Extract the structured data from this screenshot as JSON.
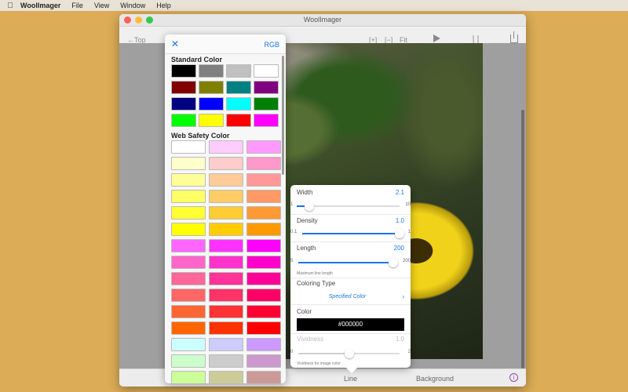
{
  "menubar": {
    "app": "WoolImager",
    "items": [
      "File",
      "View",
      "Window",
      "Help"
    ]
  },
  "window": {
    "title": "WoolImager"
  },
  "toolbar": {
    "back": "←Top",
    "expand": "[+]",
    "shrink": "[−]",
    "fit": "Fit"
  },
  "bottombar": {
    "line_tab": "Line",
    "background_tab": "Background"
  },
  "picker": {
    "rgb_label": "RGB",
    "standard_title": "Standard Color",
    "standard_colors": [
      "#000000",
      "#808080",
      "#c0c0c0",
      "#ffffff",
      "#800000",
      "#808000",
      "#008080",
      "#800080",
      "#000080",
      "#0000ff",
      "#00ffff",
      "#008000",
      "#00ff00",
      "#ffff00",
      "#ff0000",
      "#ff00ff"
    ],
    "web_title": "Web Safety Color",
    "web_colors": [
      "#ffffff",
      "#ffccff",
      "#ff99ff",
      "#ffffcc",
      "#ffcccc",
      "#ff99cc",
      "#ffff99",
      "#ffcc99",
      "#ff9999",
      "#ffff66",
      "#ffcc66",
      "#ff9966",
      "#ffff33",
      "#ffcc33",
      "#ff9933",
      "#ffff00",
      "#ffcc00",
      "#ff9900",
      "#ff66ff",
      "#ff33ff",
      "#ff00ff",
      "#ff66cc",
      "#ff33cc",
      "#ff00cc",
      "#ff6699",
      "#ff3399",
      "#ff0099",
      "#ff6666",
      "#ff3366",
      "#ff0066",
      "#ff6633",
      "#ff3333",
      "#ff0033",
      "#ff6600",
      "#ff3300",
      "#ff0000",
      "#ccffff",
      "#ccccff",
      "#cc99ff",
      "#ccffcc",
      "#cccccc",
      "#cc99cc",
      "#ccff99",
      "#cccc99",
      "#cc9999"
    ]
  },
  "settings": {
    "width": {
      "label": "Width",
      "value": "2.1",
      "min": "1",
      "max": "10",
      "level": 0.12
    },
    "density": {
      "label": "Density",
      "value": "1.0",
      "min": "0.1",
      "max": "1",
      "level": 1.0
    },
    "length": {
      "label": "Length",
      "value": "200",
      "min": "5",
      "max": "200",
      "level": 1.0,
      "note": "Maximum line length"
    },
    "coloring_type": {
      "label": "Coloring Type",
      "value": "Specified Color"
    },
    "color": {
      "label": "Color",
      "value": "#000000"
    },
    "vividness": {
      "label": "Vividness",
      "value": "1.0",
      "min": "0",
      "max": "2",
      "level": 0.5,
      "note": "Vividness for image color"
    }
  }
}
